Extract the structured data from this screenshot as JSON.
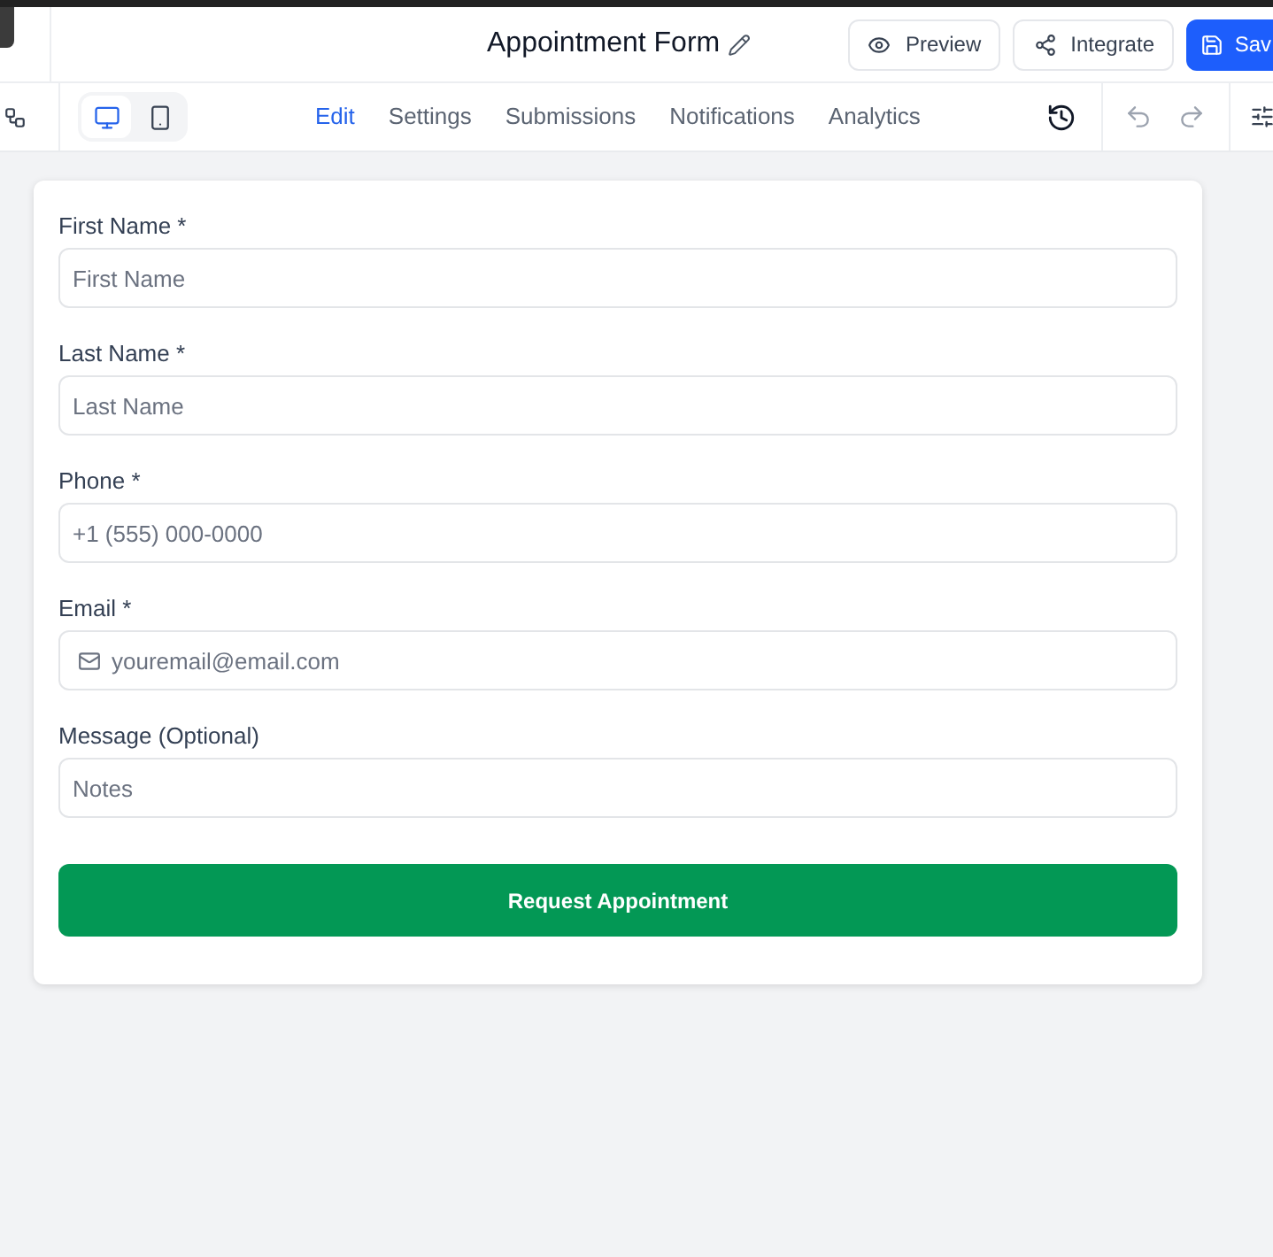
{
  "header": {
    "title": "Appointment Form",
    "buttons": [
      {
        "label": "Preview",
        "kind": "preview"
      },
      {
        "label": "Integrate",
        "kind": "integrate"
      },
      {
        "label": "Sav",
        "kind": "save"
      }
    ]
  },
  "toolbar": {
    "devices": [
      {
        "kind": "desktop",
        "selected": true
      },
      {
        "kind": "mobile",
        "selected": false
      }
    ],
    "tabs": [
      {
        "label": "Edit",
        "selected": true
      },
      {
        "label": "Settings",
        "selected": false
      },
      {
        "label": "Submissions",
        "selected": false
      },
      {
        "label": "Notifications",
        "selected": false
      },
      {
        "label": "Analytics",
        "selected": false
      }
    ],
    "history": [
      {
        "kind": "undo",
        "disabled": true
      },
      {
        "kind": "redo",
        "disabled": true
      }
    ]
  },
  "form": {
    "fields": [
      {
        "label": "First Name *",
        "placeholder": "First Name",
        "kind": "text"
      },
      {
        "label": "Last Name *",
        "placeholder": "Last Name",
        "kind": "text"
      },
      {
        "label": "Phone *",
        "placeholder": "+1 (555) 000-0000",
        "kind": "text"
      },
      {
        "label": "Email *",
        "placeholder": "youremail@email.com",
        "kind": "email"
      },
      {
        "label": "Message (Optional)",
        "placeholder": "Notes",
        "kind": "text"
      }
    ],
    "submit": "Request Appointment"
  }
}
